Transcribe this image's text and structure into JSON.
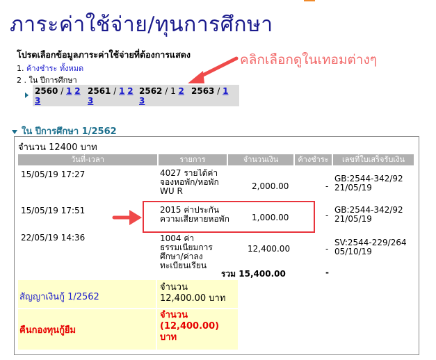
{
  "page": {
    "title": "ภาระค่าใช้จ่าย/ทุนการศึกษา",
    "prompt": "โปรดเลือกข้อมูลภาระค่าใช้จ่ายที่ต้องการแสดง",
    "option1_prefix": "1.",
    "option1_link": "ค้างชำระ ทั้งหมด",
    "option2_label": "2 . ใน ปีการศึกษา",
    "annotation": "คลิกเลือกดูในเทอมต่างๆ"
  },
  "terms": [
    {
      "year": "2560",
      "sep": " / ",
      "t1": "1",
      "t2": "2",
      "t3": "3"
    },
    {
      "year": "2561",
      "sep": " / ",
      "t1": "1",
      "t2": "2",
      "t3": "3"
    },
    {
      "year": "2562",
      "sep": " / ",
      "t1": "1",
      "t2": "2",
      "t3": "3"
    },
    {
      "year": "2563",
      "sep": " / ",
      "t1": "1"
    }
  ],
  "section": {
    "title": "ใน ปีการศึกษา 1/2562",
    "amount_label": "จำนวน 12400 บาท"
  },
  "table": {
    "headers": [
      "วันที่-เวลา",
      "รายการ",
      "จำนวนเงิน",
      "ค้างชำระ",
      "เลขที่ใบเสร็จรับเงิน"
    ],
    "rows": [
      {
        "datetime": "15/05/19 17:27",
        "item": "4027 รายได้ค่าจองหอพัก/หอพัก WU R",
        "amount": "2,000.00",
        "due": "-",
        "receipt": "GB:2544-342/92 21/05/19"
      },
      {
        "datetime": "15/05/19 17:51",
        "item": "2015 ค่าประกันความเสียหายหอพัก",
        "amount": "1,000.00",
        "due": "-",
        "receipt": "GB:2544-342/92 21/05/19"
      },
      {
        "datetime": "22/05/19 14:36",
        "item": "1004 ค่าธรรมเนียมการศึกษา/ค่าลงทะเบียนเรียน",
        "amount": "12,400.00",
        "due": "-",
        "receipt": "SV:2544-229/264 05/10/19"
      }
    ],
    "total_label": "รวม",
    "total_value": "15,400.00",
    "total_due": "-"
  },
  "loan": {
    "label": "สัญญาเงินกู้ 1/2562",
    "amount_line1": "จำนวน",
    "amount_line2": "12,400.00 บาท"
  },
  "refund": {
    "label": "คืนกองทุนกู้ยืม",
    "amount_line1": "จำนวน",
    "amount_line2": "(12,400.00)",
    "amount_line3": "บาท"
  },
  "colors": {
    "title": "#1a1a8c",
    "link": "#1a1acc",
    "annotation": "#f26b6b",
    "highlight": "#e8333b",
    "header_bg": "#b0b0b0",
    "yellow_bg": "#ffffcc",
    "refund_text": "#e60000"
  }
}
